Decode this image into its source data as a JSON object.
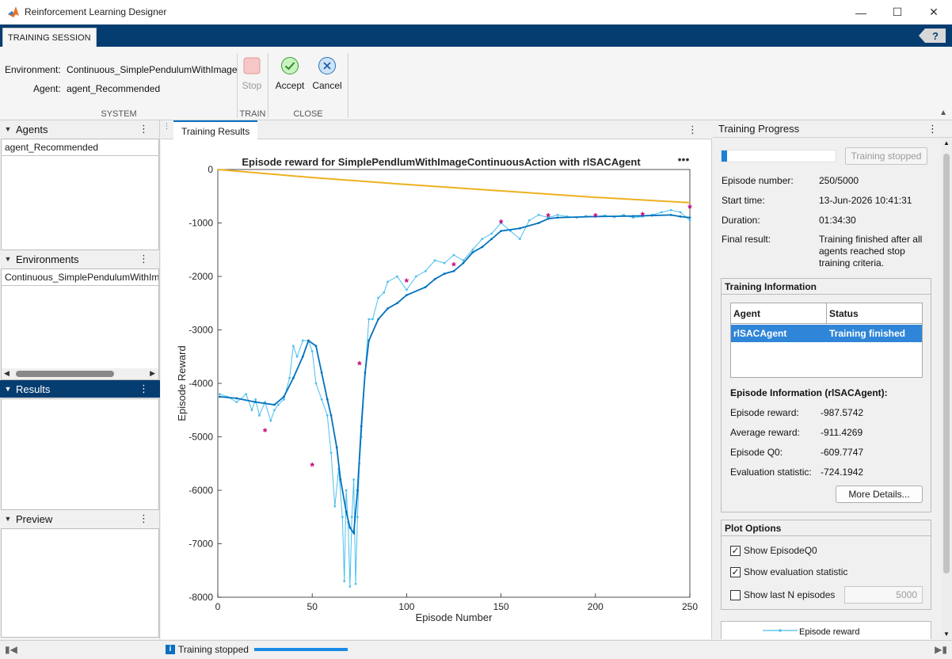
{
  "window": {
    "title": "Reinforcement Learning Designer"
  },
  "tabstrip": {
    "tab_label": "TRAINING SESSION"
  },
  "toolstrip": {
    "env_label": "Environment:",
    "env_value": "Continuous_SimplePendulumWithImage",
    "agent_label": "Agent:",
    "agent_value": "agent_Recommended",
    "system_label": "SYSTEM",
    "stop_label": "Stop",
    "train_label": "TRAIN",
    "accept_label": "Accept",
    "cancel_label": "Cancel",
    "close_label": "CLOSE"
  },
  "left": {
    "agents_header": "Agents",
    "agents": [
      "agent_Recommended"
    ],
    "environments_header": "Environments",
    "environments": [
      "Continuous_SimplePendulumWithIm"
    ],
    "results_header": "Results",
    "preview_header": "Preview"
  },
  "doc": {
    "tab_label": "Training Results"
  },
  "chart_data": {
    "type": "line",
    "title": "Episode reward for SimplePendlumWithImageContinuousAction with rlSACAgent",
    "xlabel": "Episode Number",
    "ylabel": "Episode Reward",
    "xlim": [
      0,
      250
    ],
    "ylim": [
      -8000,
      0
    ],
    "xticks": [
      "0",
      "50",
      "100",
      "150",
      "200",
      "250"
    ],
    "yticks": [
      "0",
      "-1000",
      "-2000",
      "-3000",
      "-4000",
      "-5000",
      "-6000",
      "-7000",
      "-8000"
    ],
    "series": [
      {
        "name": "Episode reward",
        "color": "#4dbeee",
        "x": [
          1,
          5,
          10,
          15,
          18,
          20,
          22,
          25,
          28,
          30,
          32,
          35,
          38,
          40,
          42,
          45,
          48,
          50,
          52,
          55,
          58,
          60,
          62,
          64,
          66,
          67,
          68,
          69,
          70,
          71,
          72,
          73,
          74,
          75,
          76,
          78,
          80,
          82,
          85,
          88,
          90,
          95,
          100,
          105,
          110,
          115,
          120,
          125,
          130,
          135,
          140,
          145,
          150,
          155,
          160,
          165,
          170,
          175,
          180,
          185,
          190,
          195,
          200,
          205,
          210,
          215,
          220,
          225,
          230,
          235,
          240,
          245,
          250
        ],
        "y": [
          -4200,
          -4250,
          -4350,
          -4200,
          -4500,
          -4300,
          -4600,
          -4350,
          -4700,
          -4500,
          -4400,
          -4300,
          -3900,
          -3300,
          -3500,
          -3200,
          -3200,
          -3400,
          -4000,
          -4300,
          -4600,
          -5300,
          -6300,
          -5600,
          -6500,
          -7700,
          -6000,
          -6600,
          -7800,
          -6500,
          -5800,
          -7750,
          -6500,
          -5500,
          -5000,
          -3800,
          -2800,
          -2800,
          -2400,
          -2300,
          -2100,
          -2000,
          -2250,
          -2000,
          -1900,
          -1700,
          -1750,
          -1600,
          -1700,
          -1500,
          -1300,
          -1200,
          -1000,
          -1150,
          -1300,
          -950,
          -850,
          -900,
          -850,
          -880,
          -900,
          -870,
          -880,
          -860,
          -890,
          -850,
          -900,
          -880,
          -850,
          -800,
          -760,
          -800,
          -950
        ]
      },
      {
        "name": "Average reward",
        "color": "#0072bd",
        "x": [
          1,
          10,
          20,
          30,
          35,
          40,
          45,
          48,
          52,
          55,
          58,
          60,
          63,
          65,
          68,
          70,
          72,
          74,
          76,
          78,
          80,
          85,
          90,
          95,
          100,
          110,
          115,
          120,
          125,
          130,
          135,
          140,
          145,
          150,
          160,
          170,
          175,
          180,
          200,
          220,
          230,
          240,
          245,
          250
        ],
        "y": [
          -4250,
          -4280,
          -4350,
          -4400,
          -4250,
          -3900,
          -3500,
          -3200,
          -3300,
          -3800,
          -4300,
          -4600,
          -5200,
          -5800,
          -6400,
          -6700,
          -6800,
          -6000,
          -4800,
          -3800,
          -3200,
          -2800,
          -2600,
          -2500,
          -2350,
          -2200,
          -2050,
          -1950,
          -1900,
          -1750,
          -1550,
          -1450,
          -1300,
          -1150,
          -1100,
          -1000,
          -920,
          -900,
          -880,
          -870,
          -860,
          -850,
          -880,
          -900
        ]
      },
      {
        "name": "Episode Q0",
        "color": "#edb120",
        "x": [
          0,
          50,
          100,
          150,
          200,
          250
        ],
        "y": [
          0,
          -150,
          -280,
          -400,
          -520,
          -620
        ]
      },
      {
        "name": "Evaluation statistic",
        "color": "#c0007a",
        "x": [
          25,
          50,
          75,
          100,
          125,
          150,
          175,
          200,
          225,
          250
        ],
        "y": [
          -4900,
          -5550,
          -3650,
          -2100,
          -1800,
          -1000,
          -880,
          -880,
          -860,
          -720
        ]
      }
    ]
  },
  "right": {
    "title": "Training Progress",
    "progress_fraction": 0.05,
    "stopped_button": "Training stopped",
    "episode_number_label": "Episode number:",
    "episode_number": "250/5000",
    "start_time_label": "Start time:",
    "start_time": "13-Jun-2026 10:41:31",
    "duration_label": "Duration:",
    "duration": "01:34:30",
    "final_result_label": "Final result:",
    "final_result": "Training finished after all agents reached stop training criteria.",
    "training_info_title": "Training Information",
    "table_agent_header": "Agent",
    "table_status_header": "Status",
    "table_agent": "rlSACAgent",
    "table_status": "Training finished",
    "episode_info_title": "Episode Information (rlSACAgent):",
    "episode_reward_label": "Episode reward:",
    "episode_reward": "-987.5742",
    "average_reward_label": "Average reward:",
    "average_reward": "-911.4269",
    "episode_q0_label": "Episode Q0:",
    "episode_q0": "-609.7747",
    "eval_stat_label": "Evaluation statistic:",
    "eval_stat": "-724.1942",
    "more_details": "More Details...",
    "plot_options_title": "Plot Options",
    "show_q0": "Show EpisodeQ0",
    "show_eval": "Show evaluation statistic",
    "show_last_n": "Show last N episodes",
    "last_n_value": "5000",
    "legend_item": "Episode reward"
  },
  "status": {
    "text": "Training stopped"
  }
}
